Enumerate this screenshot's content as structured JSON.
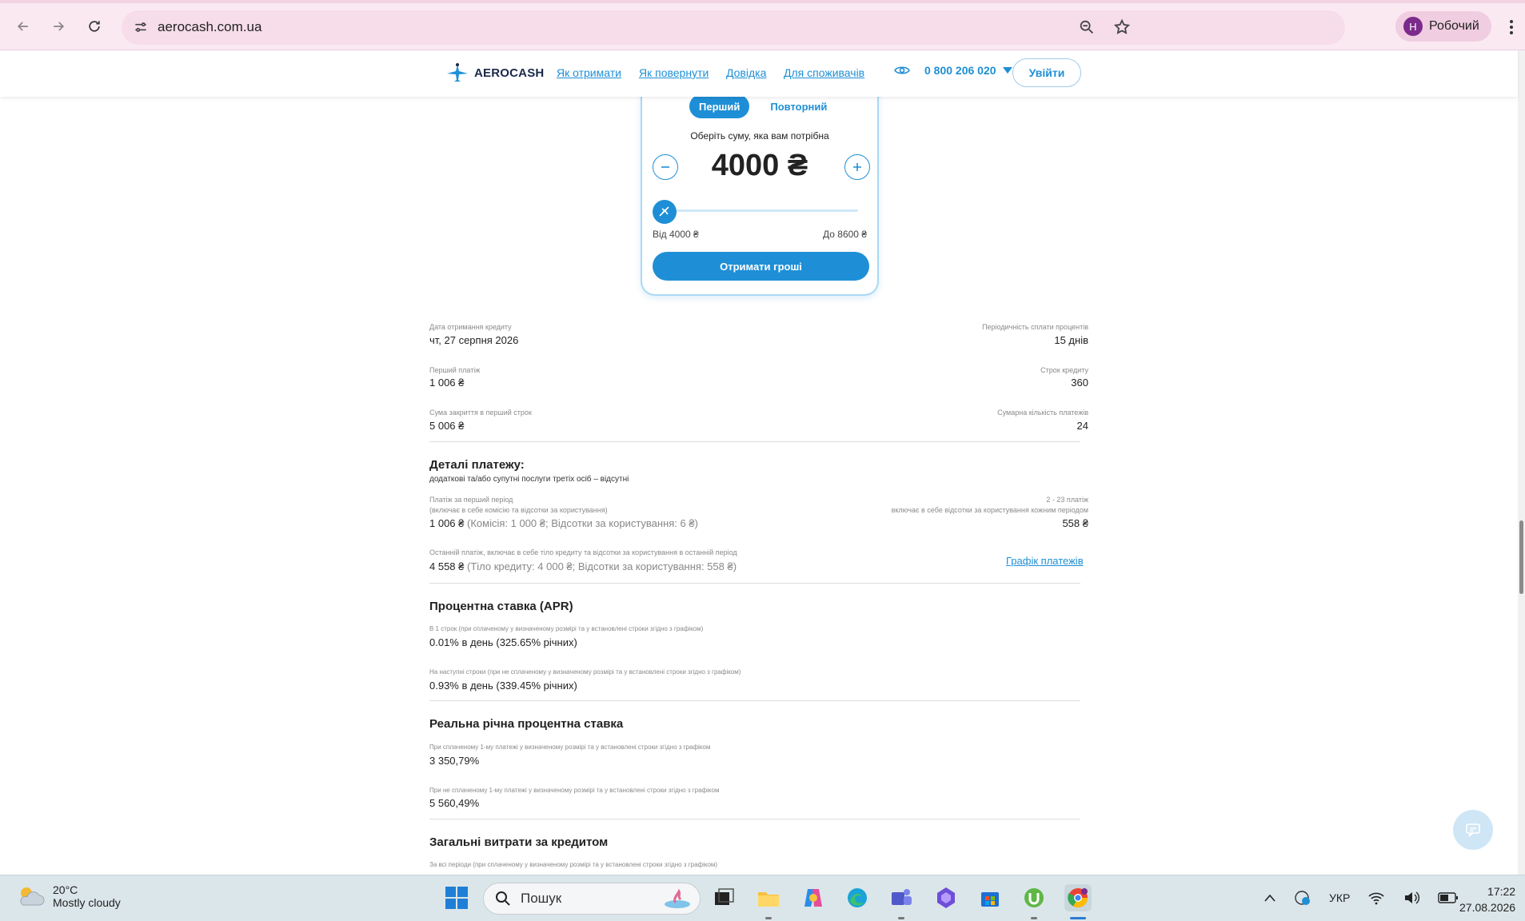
{
  "browser": {
    "url": "aerocash.com.ua",
    "profile_initial": "Н",
    "profile_name": "Робочий"
  },
  "header": {
    "logo_text": "AEROCASH",
    "nav": [
      "Як отримати",
      "Як повернути",
      "Довідка",
      "Для споживачів"
    ],
    "phone": "0 800 206 020",
    "login_label": "Увійти"
  },
  "calculator": {
    "tab_first": "Перший",
    "tab_repeat": "Повторний",
    "choose_label": "Оберіть суму, яка вам потрібна",
    "amount": "4000 ₴",
    "range_min": "Від 4000 ₴",
    "range_max": "До 8600 ₴",
    "slider_fraction": 0,
    "cta_label": "Отримати гроші"
  },
  "summary": {
    "date_label": "Дата отримання кредиту",
    "date_value": "чт, 27 серпня 2026",
    "period_label": "Періодичність сплати процентів",
    "period_value": "15 днів",
    "first_payment_label": "Перший платіж",
    "first_payment_value": "1 006 ₴",
    "term_label": "Строк кредиту",
    "term_value": "360",
    "close_sum_label": "Сума закриття в перший строк",
    "close_sum_value": "5 006 ₴",
    "payments_count_label": "Сумарна кількість платежів",
    "payments_count_value": "24"
  },
  "details": {
    "title": "Деталі платежу:",
    "subtitle": "додаткові та/або супутні послуги третіх осіб – відсутні",
    "first_period_label": "Платіж за перший період",
    "first_period_sub": "(включає в себе комісію та відсотки за користування)",
    "first_period_value": "1 006 ₴",
    "first_period_breakdown": "(Комісія: 1 000 ₴; Відсотки за користування: 6 ₴)",
    "mid_label": "2 - 23 платіж",
    "mid_sub": "включає в себе відсотки за користування кожним періодом",
    "mid_value": "558 ₴",
    "last_label": "Останній платіж, включає в себе тіло кредиту та відсотки за користування в останній період",
    "last_value": "4 558 ₴",
    "last_breakdown": "(Тіло кредиту: 4 000 ₴; Відсотки за користування: 558 ₴)",
    "schedule_link": "Графік платежів"
  },
  "apr": {
    "title": "Процентна ставка (APR)",
    "first_label": "В 1 строк (при сплаченому у визначеному розмірі та у встановлені строки згідно з графіком)",
    "first_value": "0.01% в день (325.65% річних)",
    "next_label": "На наступні строки (при не сплаченому у визначеному розмірі та у встановлені строки згідно з графіком)",
    "next_value": "0.93% в день (339.45% річних)"
  },
  "real_rate": {
    "title": "Реальна річна процентна ставка",
    "paid_label": "При сплаченому 1-му платежі у визначеному розмірі та у встановлені строки згідно з графіком",
    "paid_value": "3 350,79%",
    "unpaid_label": "При не сплаченому 1-му платежі у визначеному розмірі та у встановлені строки згідно з графіком",
    "unpaid_value": "5 560,49%"
  },
  "total_costs": {
    "title": "Загальні витрати за кредитом",
    "all_label": "За всі періоди (при сплаченому у визначеному розмірі та у встановлені строки згідно з графіком)"
  },
  "taskbar": {
    "temp": "20°C",
    "weather": "Mostly cloudy",
    "search_placeholder": "Пошук",
    "lang": "УКР",
    "time": "17:22",
    "date": "27.08.2026"
  },
  "colors": {
    "accent": "#1e8fd6",
    "browser_chrome": "#fbe9f1"
  }
}
